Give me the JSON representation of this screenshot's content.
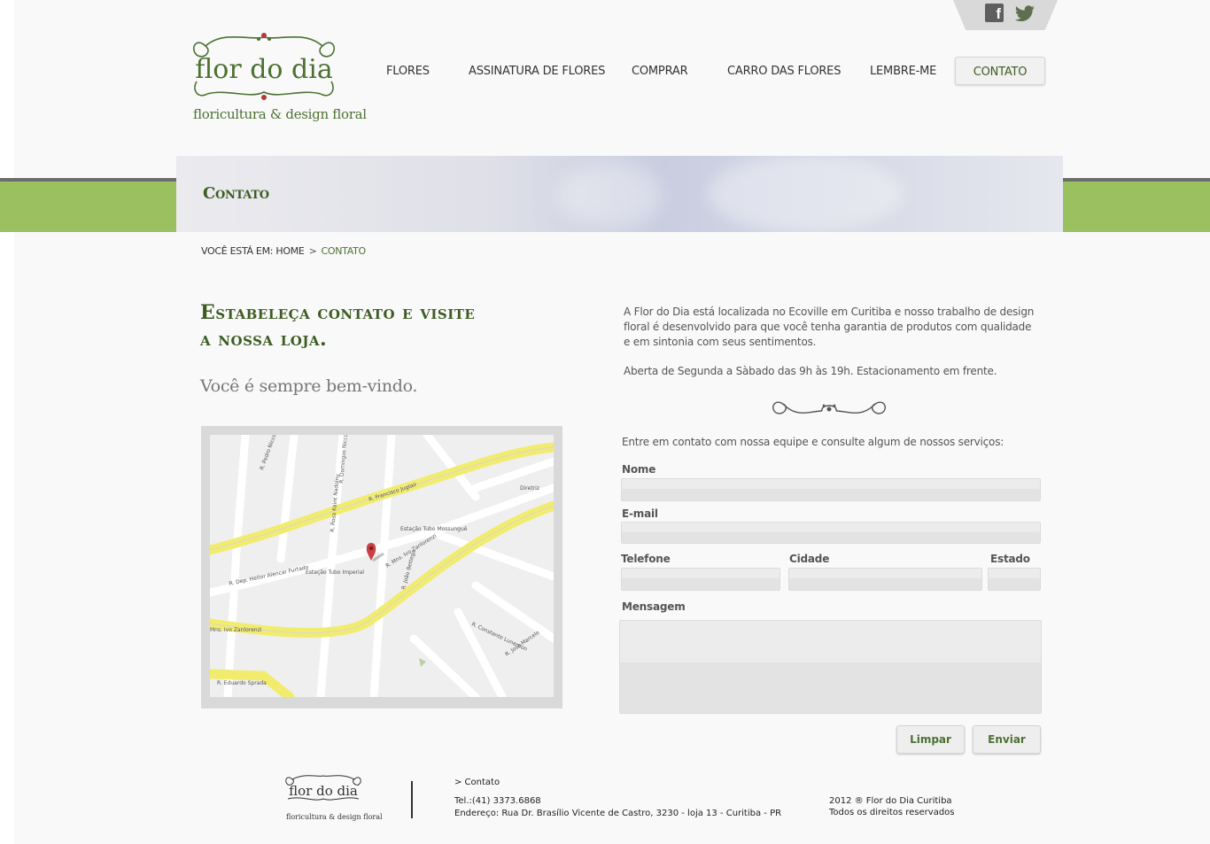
{
  "brand": {
    "logo_word": "flor do dia",
    "tagline": "floricultura & design floral"
  },
  "nav": {
    "items": [
      {
        "label": "FLORES"
      },
      {
        "label": "ASSINATURA DE FLORES"
      },
      {
        "label": "COMPRAR"
      },
      {
        "label": "CARRO DAS FLORES"
      },
      {
        "label": "LEMBRE-ME"
      },
      {
        "label": "CONTATO"
      }
    ]
  },
  "banner": {
    "title": "Contato"
  },
  "breadcrumb": {
    "prefix": "VOCÊ ESTÁ EM:",
    "home": "HOME",
    "separator": ">",
    "current": "CONTATO"
  },
  "main": {
    "headline": "Estabeleça contato e visite a nossa loja.",
    "welcome": "Você é sempre bem-vindo.",
    "intro": "A Flor do Dia está localizada no Ecoville em Curitiba e nosso trabalho de design floral é desenvolvido para que você tenha garantia de produtos com qualidade e em sintonia com seus sentimentos.",
    "hours": "Aberta de Segunda a Sàbado das 9h às 19h. Estacionamento em frente."
  },
  "map": {
    "streets": [
      "R. Pedro Nicco",
      "R. Domingos Nicco",
      "R. Rosa Kaint Nadolny",
      "R. Francisco Juglair",
      "R. Dep. Heitor Alencar Furtado",
      "R. Mns. Ivo Zanlorenzi",
      "Mns. Ivo Zanlorenzi",
      "R. Eduardo Sprada",
      "R. João Bettega",
      "R. Jose Marcelo",
      "R. Constante Lunardon",
      "Estação Tubo Imperial",
      "Estação Tubo Mossunguê",
      "Diretriz"
    ]
  },
  "form": {
    "intro": "Entre em contato com nossa equipe e consulte algum de nossos serviços:",
    "nome_label": "Nome",
    "email_label": "E-mail",
    "telefone_label": "Telefone",
    "cidade_label": "Cidade",
    "estado_label": "Estado",
    "mensagem_label": "Mensagem",
    "nome_value": "",
    "email_value": "",
    "telefone_value": "",
    "cidade_value": "",
    "estado_value": "",
    "mensagem_value": "",
    "clear_label": "Limpar",
    "send_label": "Enviar"
  },
  "footer": {
    "nav": "> Contato",
    "tel": "Tel.:(41) 3373.6868",
    "address": "Endereço: Rua Dr. Brasílio Vicente de Castro, 3230 - loja 13 - Curitiba - PR",
    "copyright": "2012 ® Flor do Dia Curitiba",
    "rights": "Todos os direitos reservados"
  },
  "colors": {
    "accent_green": "#3d5c22",
    "bar_green": "#9bc060",
    "road_yellow": "#f2ec6e"
  },
  "icons": [
    "facebook-icon",
    "twitter-icon",
    "map-pin-icon",
    "ornament-divider"
  ]
}
